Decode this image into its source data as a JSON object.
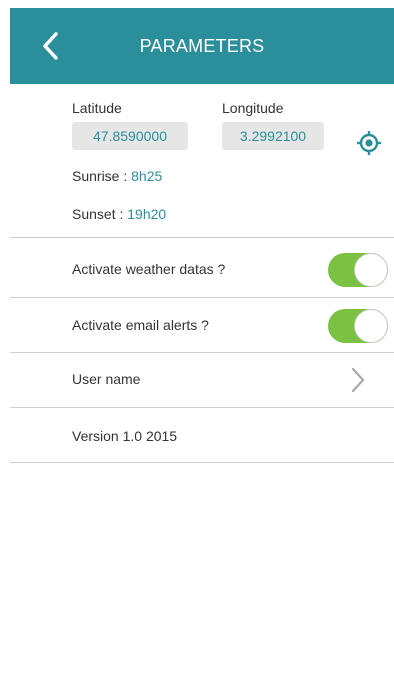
{
  "header": {
    "title": "PARAMETERS"
  },
  "location": {
    "latitude_label": "Latitude",
    "latitude_value": "47.8590000",
    "longitude_label": "Longitude",
    "longitude_value": "3.2992100",
    "sunrise_label": "Sunrise : ",
    "sunrise_value": "8h25",
    "sunset_label": "Sunset : ",
    "sunset_value": "19h20"
  },
  "settings": [
    {
      "label": "Activate weather datas ?",
      "control": "toggle",
      "on": true
    },
    {
      "label": "Activate email alerts ?",
      "control": "toggle",
      "on": true
    },
    {
      "label": "User name",
      "control": "chevron"
    },
    {
      "label": "Version 1.0 2015",
      "control": "none"
    }
  ],
  "colors": {
    "header_bg": "#2a8f9b",
    "accent_text": "#2a8f9b",
    "toggle_on": "#7cc142",
    "value_box_bg": "#e6e6e6"
  },
  "icons": {
    "back": "chevron-left-icon",
    "locate": "gps-target-icon",
    "chevron": "chevron-right-icon"
  }
}
